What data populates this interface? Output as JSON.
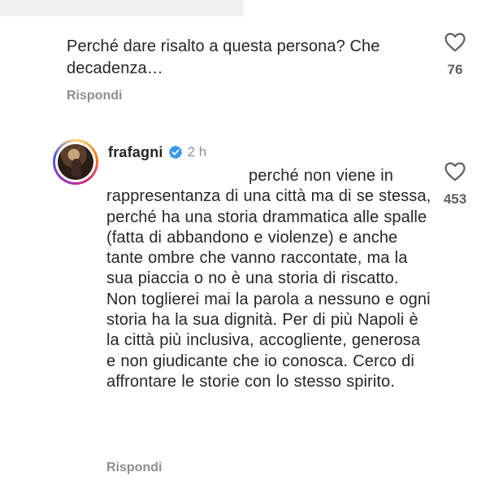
{
  "comments": {
    "top": {
      "text": "Perché dare risalto a questa persona? Che decadenza…",
      "reply_label": "Rispondi",
      "likes": "76"
    },
    "main": {
      "username": "frafagni",
      "verified_icon": "verified-badge-icon",
      "timestamp": "2 h",
      "text": "perché non viene in rappresentanza di una città ma di se stessa, perché ha una storia drammatica alle spalle (fatta di abbandono e violenze) e anche tante ombre che vanno raccontate, ma la sua piaccia o no è una storia di riscatto. Non toglierei mai la parola a nessuno e ogni storia ha la sua dignità. Per di più Napoli è la città più inclusiva, accogliente, generosa e non giudicante che io conosca. Cerco di affrontare le storie con lo stesso spirito.",
      "reply_label": "Rispondi",
      "likes": "453"
    }
  },
  "icons": {
    "like": "heart-outline-icon",
    "verified": "verified-badge-icon"
  },
  "colors": {
    "text": "#262626",
    "secondary_text": "#8e8e8e",
    "verified_blue": "#3897f0"
  }
}
